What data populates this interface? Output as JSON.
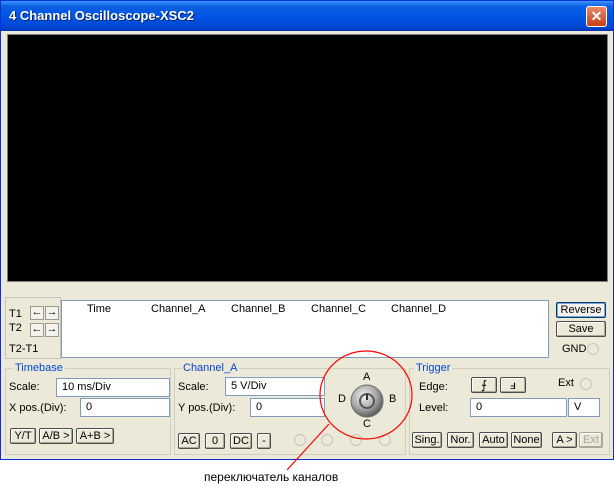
{
  "window": {
    "title": "4 Channel Oscilloscope-XSC2",
    "close_glyph": "✕"
  },
  "cursors": {
    "t1": "T1",
    "t2": "T2",
    "t2_t1": "T2-T1"
  },
  "readout": {
    "columns": [
      "Time",
      "Channel_A",
      "Channel_B",
      "Channel_C",
      "Channel_D"
    ]
  },
  "side": {
    "reverse": "Reverse",
    "save": "Save",
    "gnd": "GND"
  },
  "timebase": {
    "title": "Timebase",
    "scale_label": "Scale:",
    "scale_value": "10 ms/Div",
    "xpos_label": "X pos.(Div):",
    "xpos_value": "0",
    "yt": "Y/T",
    "ab": "A/B >",
    "apb": "A+B >"
  },
  "channel": {
    "title": "Channel_A",
    "scale_label": "Scale:",
    "scale_value": "5  V/Div",
    "ypos_label": "Y pos.(Div):",
    "ypos_value": "0",
    "ac": "AC",
    "zero": "0",
    "dc": "DC",
    "minus": "-"
  },
  "knob": {
    "a": "A",
    "b": "B",
    "c": "C",
    "d": "D"
  },
  "trigger": {
    "title": "Trigger",
    "edge_label": "Edge:",
    "ext_label": "Ext",
    "level_label": "Level:",
    "level_value": "0",
    "level_unit": "V",
    "sing": "Sing.",
    "nor": "Nor.",
    "auto": "Auto",
    "none": "None",
    "src": "A >",
    "ext_btn": "Ext"
  },
  "annotation": {
    "caption": "переключатель каналов",
    "color": "#ff0000"
  }
}
